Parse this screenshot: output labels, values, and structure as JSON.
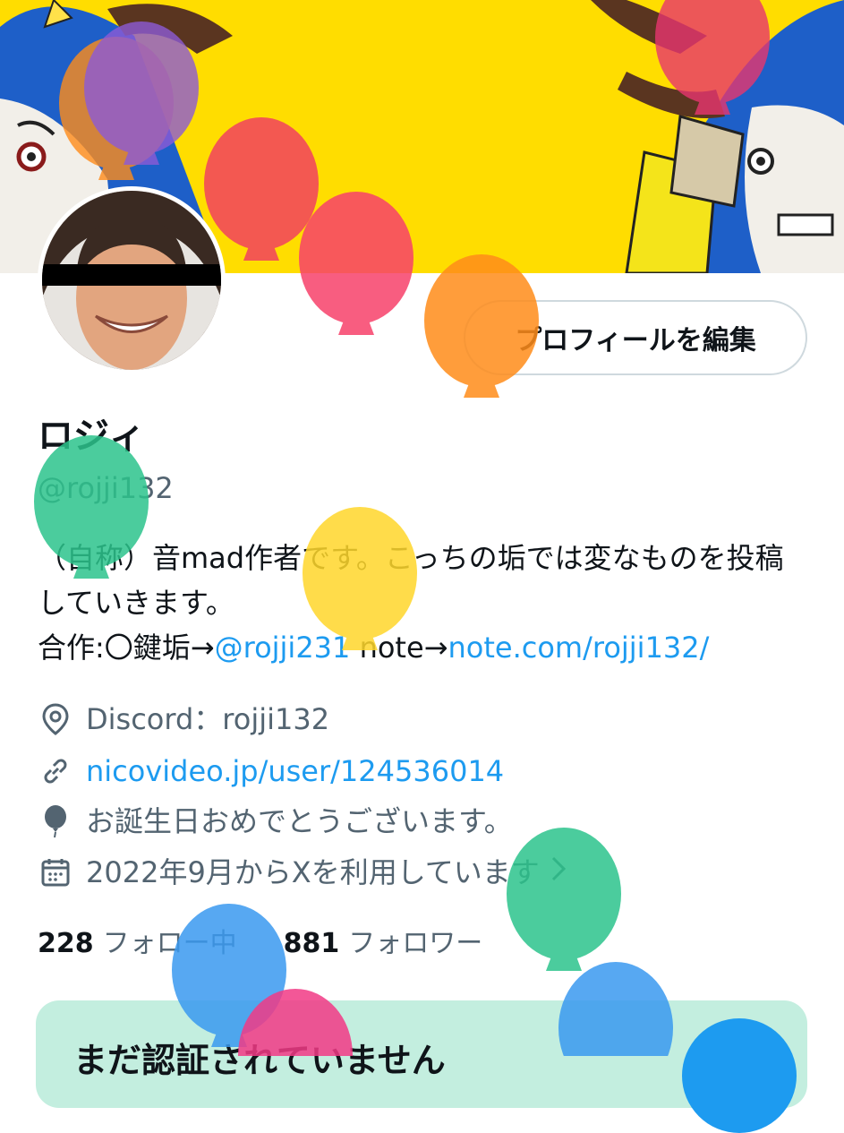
{
  "profile": {
    "edit_button_label": "プロフィールを編集",
    "display_name": "ロジィ",
    "handle": "@rojji132",
    "bio": {
      "line1": "（自称）音mad作者です。こっちの垢では変なものを投稿していきます。",
      "line3_prefix": "合作:〇鍵垢→",
      "mention": "@rojji231",
      "line3_mid": " note→",
      "link": "note.com/rojji132/"
    },
    "location": "Discord：rojji132",
    "website": "nicovideo.jp/user/124536014",
    "birthday": "お誕生日おめでとうございます。",
    "joined": "2022年9月からXを利用しています",
    "following_count": "228",
    "following_label": "フォロー中",
    "followers_count": "881",
    "followers_label": "フォロワー"
  },
  "verify_card": {
    "title": "まだ認証されていません"
  },
  "icons": {
    "location": "location-pin-icon",
    "link": "link-icon",
    "birthday": "balloon-icon",
    "joined": "calendar-icon",
    "chevron": "chevron-right-icon"
  },
  "colors": {
    "accent": "#1d9bf0",
    "banner": "#ffdd00",
    "secondary_text": "#536471",
    "verify_card_bg": "#c3eedf"
  }
}
